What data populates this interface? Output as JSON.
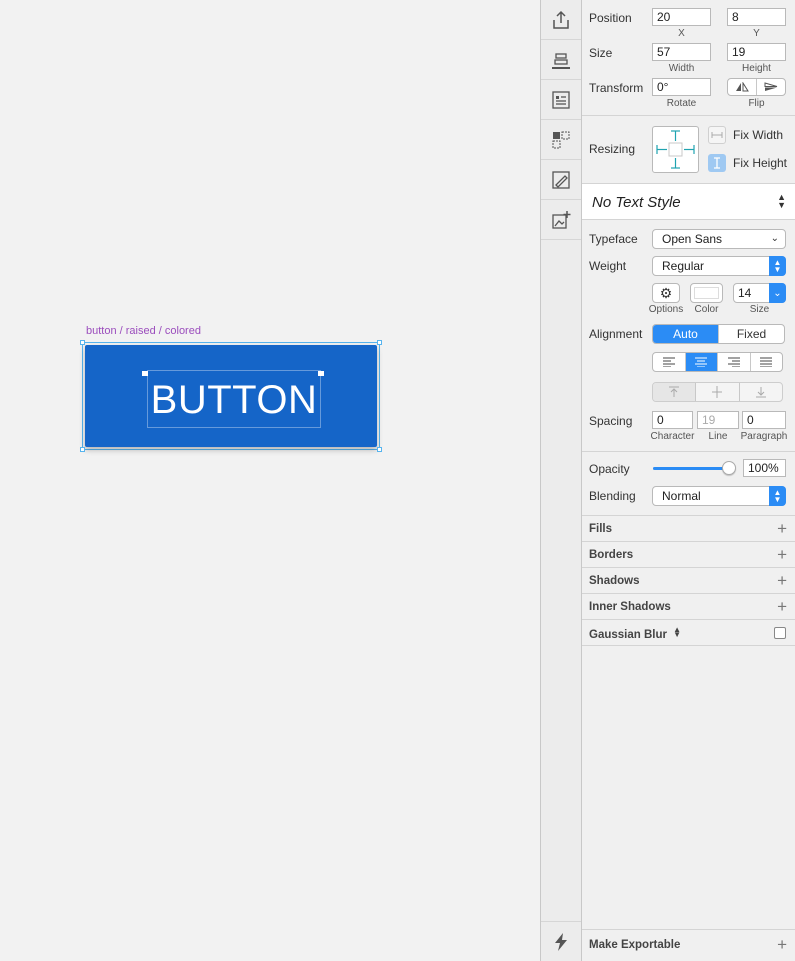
{
  "canvas": {
    "artboard_label": "button / raised / colored",
    "button_text": "BUTTON"
  },
  "toolbar": {
    "items": [
      "export-icon",
      "align-bottom-icon",
      "text-list-icon",
      "symbol-icon",
      "edit-path-icon",
      "add-image-icon"
    ],
    "bottom": "lightning-icon"
  },
  "inspector": {
    "position": {
      "label": "Position",
      "x": "20",
      "y": "8",
      "x_label": "X",
      "y_label": "Y"
    },
    "size": {
      "label": "Size",
      "width": "57",
      "height": "19",
      "width_label": "Width",
      "height_label": "Height"
    },
    "transform": {
      "label": "Transform",
      "rotate": "0°",
      "rotate_label": "Rotate",
      "flip_label": "Flip"
    },
    "resizing": {
      "label": "Resizing",
      "fix_width": "Fix Width",
      "fix_height": "Fix Height"
    },
    "text_style": "No Text Style",
    "typeface": {
      "label": "Typeface",
      "value": "Open Sans"
    },
    "weight": {
      "label": "Weight",
      "value": "Regular"
    },
    "options_label": "Options",
    "color_label": "Color",
    "size_field": {
      "value": "14",
      "label": "Size"
    },
    "alignment": {
      "label": "Alignment",
      "auto": "Auto",
      "fixed": "Fixed"
    },
    "spacing": {
      "label": "Spacing",
      "character": "0",
      "line": "19",
      "paragraph": "0",
      "character_label": "Character",
      "line_label": "Line",
      "paragraph_label": "Paragraph"
    },
    "opacity": {
      "label": "Opacity",
      "value": "100%",
      "level": 1.0
    },
    "blending": {
      "label": "Blending",
      "value": "Normal"
    },
    "sections": [
      "Fills",
      "Borders",
      "Shadows",
      "Inner Shadows",
      "Gaussian Blur"
    ],
    "make_exportable": "Make Exportable"
  },
  "colors": {
    "button": "#1565c8",
    "accent": "#2b8cf5",
    "label_purple": "#9b4dbd",
    "selection": "#57b4ee"
  }
}
